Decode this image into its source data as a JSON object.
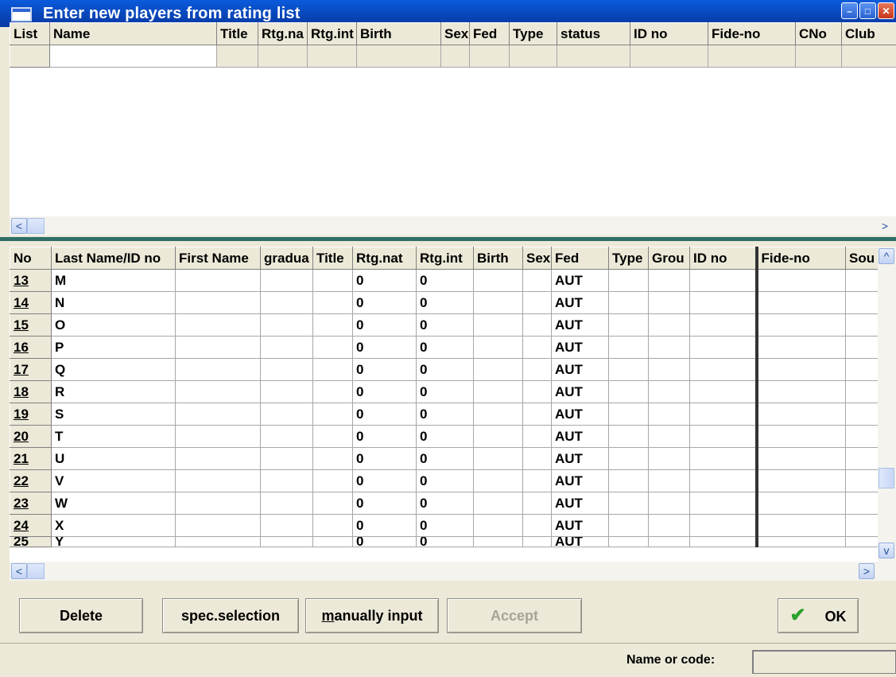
{
  "window": {
    "title": "Enter new players from rating list",
    "controls": [
      "minimize",
      "maximize",
      "close"
    ],
    "min_label": "–",
    "max_label": "□",
    "close_label": "✕"
  },
  "upper_grid": {
    "headers": [
      "List",
      "Name",
      "Title",
      "Rtg.na",
      "Rtg.int",
      "Birth",
      "Sex",
      "Fed",
      "Type",
      "status",
      "ID no",
      "Fide-no",
      "CNo",
      "Club"
    ],
    "input_value": ""
  },
  "lower_grid": {
    "headers": [
      "No",
      "Last Name/ID no",
      "First Name",
      "gradua",
      "Title",
      "Rtg.nat",
      "Rtg.int",
      "Birth",
      "Sex",
      "Fed",
      "Type",
      "Grou",
      "ID no",
      "Fide-no",
      "Sou"
    ],
    "rows": [
      {
        "no": "13",
        "last": "M",
        "rtg_nat": "0",
        "rtg_int": "0",
        "fed": "AUT"
      },
      {
        "no": "14",
        "last": "N",
        "rtg_nat": "0",
        "rtg_int": "0",
        "fed": "AUT"
      },
      {
        "no": "15",
        "last": "O",
        "rtg_nat": "0",
        "rtg_int": "0",
        "fed": "AUT"
      },
      {
        "no": "16",
        "last": "P",
        "rtg_nat": "0",
        "rtg_int": "0",
        "fed": "AUT"
      },
      {
        "no": "17",
        "last": "Q",
        "rtg_nat": "0",
        "rtg_int": "0",
        "fed": "AUT"
      },
      {
        "no": "18",
        "last": "R",
        "rtg_nat": "0",
        "rtg_int": "0",
        "fed": "AUT"
      },
      {
        "no": "19",
        "last": "S",
        "rtg_nat": "0",
        "rtg_int": "0",
        "fed": "AUT"
      },
      {
        "no": "20",
        "last": "T",
        "rtg_nat": "0",
        "rtg_int": "0",
        "fed": "AUT"
      },
      {
        "no": "21",
        "last": "U",
        "rtg_nat": "0",
        "rtg_int": "0",
        "fed": "AUT"
      },
      {
        "no": "22",
        "last": "V",
        "rtg_nat": "0",
        "rtg_int": "0",
        "fed": "AUT"
      },
      {
        "no": "23",
        "last": "W",
        "rtg_nat": "0",
        "rtg_int": "0",
        "fed": "AUT"
      },
      {
        "no": "24",
        "last": "X",
        "rtg_nat": "0",
        "rtg_int": "0",
        "fed": "AUT"
      },
      {
        "no": "25",
        "last": "Y",
        "rtg_nat": "0",
        "rtg_int": "0",
        "fed": "AUT"
      }
    ]
  },
  "buttons": {
    "delete": "Delete",
    "spec_selection": "spec.selection",
    "manually_input_mnemonic": "m",
    "manually_input_rest": "anually input",
    "accept": "Accept",
    "ok": "OK",
    "ok_check": "✔"
  },
  "status": {
    "name_label": "Name or code:",
    "name_value": ""
  },
  "scroll": {
    "left": "<",
    "right": ">",
    "up": "^",
    "down": "v"
  },
  "colors": {
    "title_bar": "#0a4fd0",
    "separator": "#2e6e66",
    "window_bg": "#ece9d8"
  }
}
